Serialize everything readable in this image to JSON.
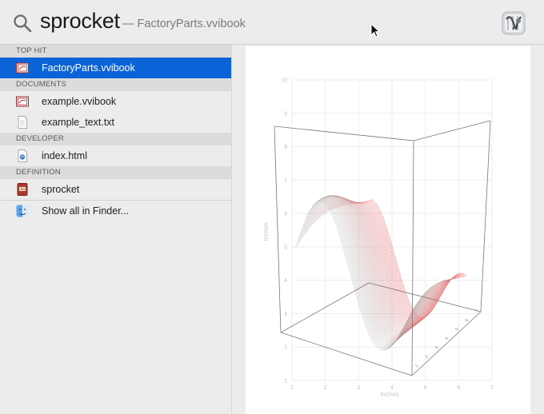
{
  "search": {
    "query": "sprocket",
    "subtitle": "— FactoryParts.vvibook"
  },
  "sidebar": {
    "sections": [
      {
        "title": "TOP HIT",
        "items": [
          {
            "label": "FactoryParts.vvibook",
            "icon": "vvibook-document-icon",
            "selected": true
          }
        ]
      },
      {
        "title": "DOCUMENTS",
        "items": [
          {
            "label": "example.vvibook",
            "icon": "vvibook-document-icon"
          },
          {
            "label": "example_text.txt",
            "icon": "text-file-icon"
          }
        ]
      },
      {
        "title": "DEVELOPER",
        "items": [
          {
            "label": "index.html",
            "icon": "html-file-icon"
          }
        ]
      },
      {
        "title": "DEFINITION",
        "items": [
          {
            "label": "sprocket",
            "icon": "dictionary-icon"
          }
        ]
      }
    ],
    "show_all": "Show all in Finder..."
  },
  "preview": {
    "xlabel": "Inches",
    "ylabel": "Inches",
    "x_ticks": [
      "1",
      "2",
      "3",
      "4",
      "5",
      "6",
      "7"
    ],
    "y_ticks": [
      "1",
      "2",
      "3",
      "4",
      "5",
      "6",
      "7",
      "8",
      "9",
      "10"
    ],
    "depth_axis_label": "Inches",
    "accent_color": "#e9959c"
  },
  "colors": {
    "selection": "#0b63d7"
  }
}
